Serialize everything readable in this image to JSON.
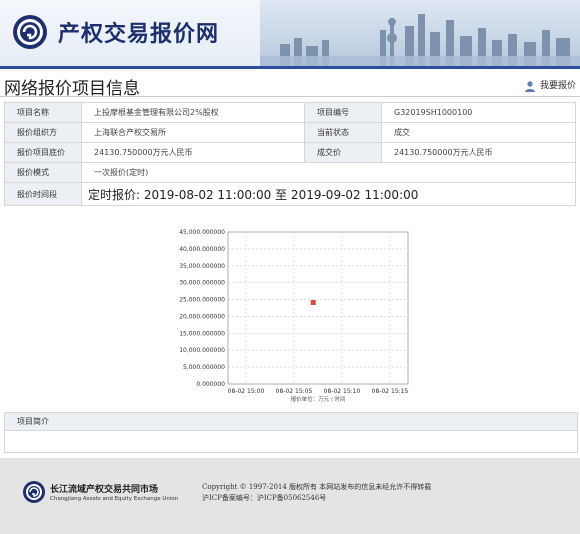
{
  "header": {
    "site_title": "产权交易报价网"
  },
  "page": {
    "title": "网络报价项目信息",
    "user_link": "我要报价"
  },
  "info": {
    "rows": [
      {
        "l1": "项目名称",
        "v1": "上投摩根基金管理有限公司2%股权",
        "l2": "项目编号",
        "v2": "G32019SH1000100"
      },
      {
        "l1": "报价组织方",
        "v1": "上海联合产权交易所",
        "l2": "当前状态",
        "v2": "成交"
      },
      {
        "l1": "报价项目底价",
        "v1": "24130.750000万元人民币",
        "l2": "成交价",
        "v2": "24130.750000万元人民币"
      },
      {
        "l1": "报价模式",
        "v1": "一次报价(定时)"
      }
    ],
    "time_label": "报价时间段",
    "time_value": "定时报价: 2019-08-02 11:00:00 至 2019-09-02 11:00:00"
  },
  "chart_data": {
    "type": "scatter",
    "y_tick_labels": [
      "45,000.000000",
      "40,000.000000",
      "35,000.000000",
      "30,000.000000",
      "25,000.000000",
      "20,000.000000",
      "15,000.000000",
      "10,000.000000",
      "5,000.000000",
      "0.000000"
    ],
    "ylim": [
      0,
      45000
    ],
    "x_tick_labels": [
      "08-02 15:00",
      "08-02 15:05",
      "08-02 15:10",
      "08-02 15:15"
    ],
    "xlabel": "报价单位：万元 / 时间",
    "points": [
      {
        "x": "08-02 15:07",
        "y": 24130.75
      }
    ],
    "grid": true,
    "point_color": "#e0453a"
  },
  "intro": {
    "label": "项目简介"
  },
  "footer": {
    "org_name": "长江流域产权交易共同市场",
    "org_name_en": "Changjiang Assets and Equity Exchange Union",
    "copyright": "Copyright © 1997-2014 版权所有 本网站发布的信息未经允许不得转载",
    "icp": "沪ICP备案编号：沪ICP备05062546号"
  }
}
